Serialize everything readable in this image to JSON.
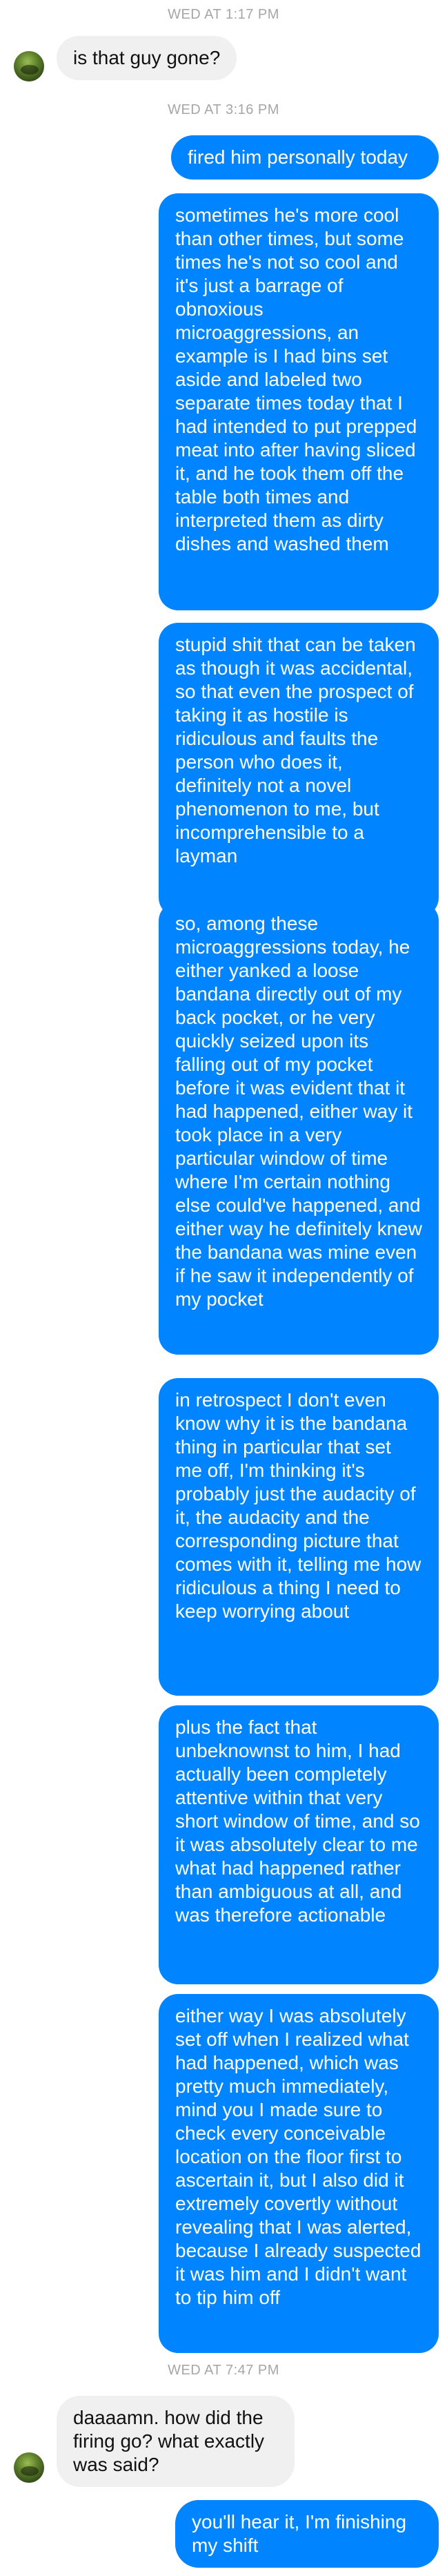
{
  "timestamps": {
    "t1": "WED AT 1:17 PM",
    "t2": "WED AT 3:16 PM",
    "t3": "WED AT 7:47 PM"
  },
  "messages": [
    {
      "from": "them",
      "text": "is that guy gone?"
    },
    {
      "from": "me",
      "text": "fired him personally today"
    },
    {
      "from": "me",
      "text": "sometimes he's more cool than other times, but some times he's not so cool and it's just a barrage of obnoxious microaggressions, an example is I had bins set aside and labeled two separate times today that I had intended to put prepped meat into after having sliced it, and he took them off the table both times and interpreted them as dirty dishes and washed them"
    },
    {
      "from": "me",
      "text": "stupid shit that can be taken as though it was accidental, so that even the prospect of taking it as hostile is ridiculous and faults the person who does it, definitely not a novel phenomenon to me, but incomprehensible to a layman"
    },
    {
      "from": "me",
      "text": "so, among these microaggressions today, he either yanked a loose bandana directly out of my back pocket, or he very quickly seized upon its falling out of my pocket before it was evident that it had happened, either way it took place in a very particular window of time where I'm certain nothing else could've happened, and either way he definitely knew the bandana was mine even if he saw it independently of my pocket"
    },
    {
      "from": "me",
      "text": "in retrospect I don't even know why it is the bandana thing in particular that set me off, I'm thinking it's probably just the audacity of it, the audacity and the corresponding picture that comes with it, telling me how ridiculous a thing I need to keep worrying about"
    },
    {
      "from": "me",
      "text": "plus the fact that unbeknownst to him, I had actually been completely attentive within that very short window of time, and so it was absolutely clear to me what had happened rather than ambiguous at all, and was therefore actionable"
    },
    {
      "from": "me",
      "text": "either way I was absolutely set off when I realized what had happened, which was pretty much immediately, mind you I made sure to check every conceivable location on the floor first to ascertain it, but I also did it extremely covertly without revealing that I was alerted, because I already suspected it was him and I didn't want to tip him off"
    },
    {
      "from": "them",
      "text": "daaaamn. how did the firing go? what exactly was said?"
    },
    {
      "from": "me",
      "text": "you'll hear it, I'm finishing my shift"
    }
  ]
}
